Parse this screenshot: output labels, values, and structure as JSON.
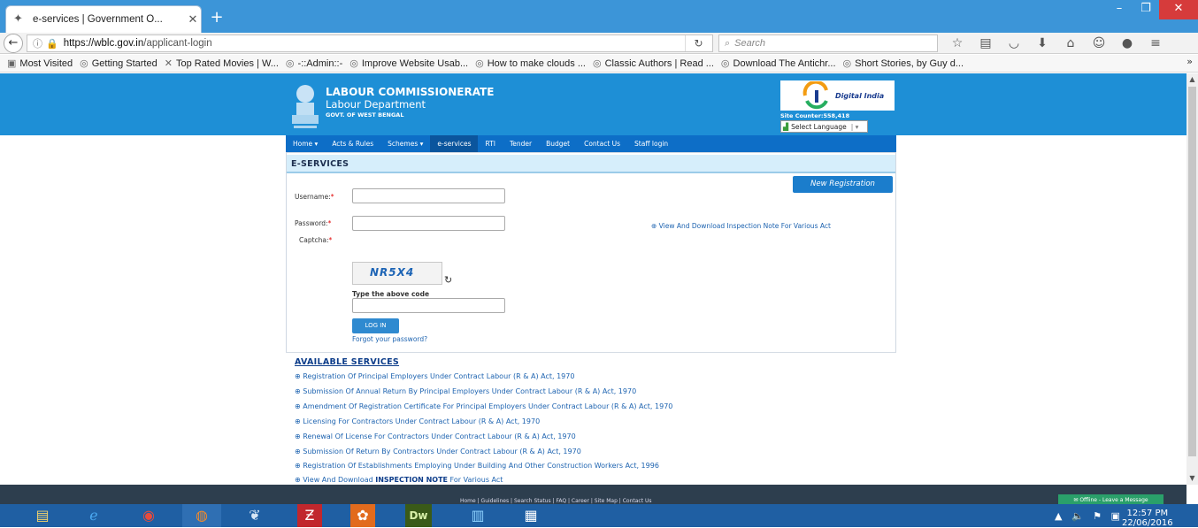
{
  "browser": {
    "tab_title": "e-services | Government O...",
    "url_host": "https://wblc.gov.in",
    "url_path": "/applicant-login",
    "search_placeholder": "Search",
    "bookmarks": [
      "Most Visited",
      "Getting Started",
      "Top Rated Movies | W...",
      "-::Admin::-",
      "Improve Website Usab...",
      "How to make clouds ...",
      "Classic Authors | Read ...",
      "Download The Antichr...",
      "Short Stories, by Guy d..."
    ]
  },
  "header": {
    "title": "LABOUR COMMISSIONERATE",
    "subtitle": "Labour Department",
    "govt": "GOVT. OF WEST BENGAL",
    "digital_india": "Digital India",
    "site_counter": "Site Counter:558,418",
    "select_language": "Select Language"
  },
  "menu": [
    "Home",
    "Acts & Rules",
    "Schemes",
    "e-services",
    "RTI",
    "Tender",
    "Budget",
    "Contact Us",
    "Staff login"
  ],
  "login": {
    "section_title": "E-SERVICES",
    "new_registration": "New Registration",
    "username_label": "Username:",
    "password_label": "Password:",
    "captcha_label": "Captcha:",
    "required_mark": "*",
    "captcha_code": "NR5X4",
    "type_code": "Type the above code",
    "login_button": "LOG IN",
    "forgot": "Forgot your password?",
    "inspection_link": "View And Download Inspection Note For Various Act"
  },
  "services": {
    "title": "AVAILABLE SERVICES",
    "items": [
      "Registration Of Principal Employers Under Contract Labour (R & A) Act, 1970",
      "Submission Of Annual Return By Principal Employers Under Contract Labour (R & A) Act, 1970",
      "Amendment Of Registration Certificate For Principal Employers Under Contract Labour (R & A) Act, 1970",
      "Licensing For Contractors Under Contract Labour (R & A) Act, 1970",
      "Renewal Of License For Contractors Under Contract Labour (R & A) Act, 1970",
      "Submission Of Return By Contractors Under Contract Labour (R & A) Act, 1970",
      "Registration Of Establishments Employing Under Building And Other Construction Workers Act, 1996"
    ],
    "last_item_prefix": "View And Download ",
    "last_item_strong": "INSPECTION NOTE",
    "last_item_suffix": " For Various Act"
  },
  "footer": {
    "links": "Home  |  Guidelines  |  Search Status  |  FAQ  |  Career  |  Site Map  |  Contact Us",
    "chat": "Offline - Leave a Message"
  },
  "taskbar": {
    "time": "12:57 PM",
    "date": "22/06/2016"
  }
}
